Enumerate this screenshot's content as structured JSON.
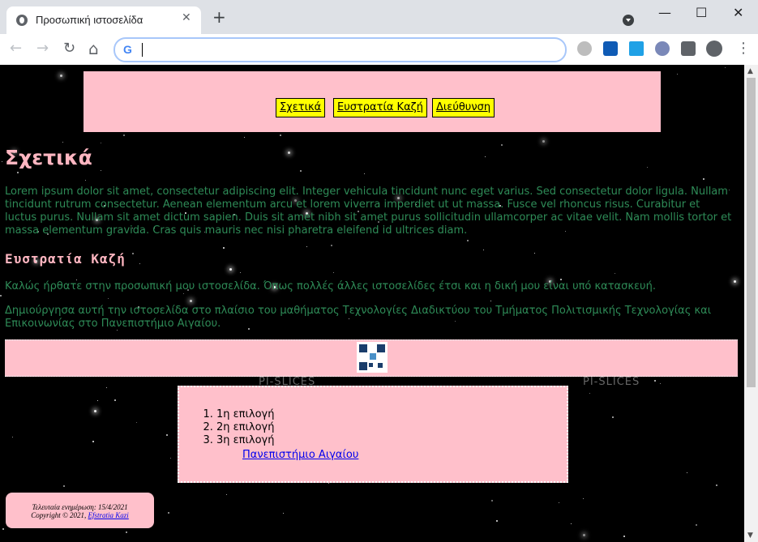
{
  "browser": {
    "tab_title": "Προσωπική ιστοσελίδα",
    "tab_close": "✕",
    "new_tab": "+",
    "window_min": "—",
    "window_max": "☐",
    "window_close": "✕",
    "back": "←",
    "forward": "→",
    "reload": "↻",
    "home": "⌂",
    "omnibox_value": "",
    "google_icon": "G",
    "menu": "⋮"
  },
  "nav": {
    "items": [
      "Σχετικά",
      "Ευστρατία Καζή",
      "Διεύθυνση"
    ]
  },
  "content": {
    "heading_about": "Σχετικά",
    "lorem": "Lorem ipsum dolor sit amet, consectetur adipiscing elit. Integer vehicula tincidunt nunc eget varius. Sed consectetur dolor ligula. Nullam tincidunt rutrum consectetur. Aenean elementum arcu et lorem viverra imperdiet ut ut massa. Fusce vel rhoncus risus. Curabitur et luctus purus. Nullam sit amet dictum sapien. Duis sit amet nibh sit amet purus sollicitudin ullamcorper ac vitae velit. Nam mollis tortor et massa elementum gravida. Cras quis mauris nec nisi pharetra eleifend id ultrices diam.",
    "heading_name": "Ευστρατία Καζή",
    "welcome": "Καλώς ήρθατε στην προσωπική μου ιστοσελίδα. Όπως πολλές άλλες ιστοσελίδες έτσι και η δική μου είναι υπό κατασκευή.",
    "created": "Δημιούργησα αυτή την ιστοσελίδα στο πλαίσιο του μαθήματος Τεχνολογίες Διαδικτύου του Τμήματος Πολιτισμικής Τεχνολογίας και Επικοινωνίας στο Πανεπιστήμιο Αιγαίου."
  },
  "watermark": "PI-SLICES",
  "list": {
    "items": [
      "1η επιλογή",
      "2η επιλογή",
      "3η επιλογή"
    ],
    "link": "Πανεπιστήμιο Αιγαίου"
  },
  "footer": {
    "updated": "Τελευταία ενημέρωση: 15/4/2021",
    "copyright_prefix": "Copyright © 2021,",
    "author_link": "Efstratia Kazi"
  },
  "colors": {
    "page_bg": "#000000",
    "nav_bg": "#ffc0cb",
    "link_box": "#ffff00",
    "heading": "#ffb6c1",
    "body_text": "#2e8b57"
  }
}
